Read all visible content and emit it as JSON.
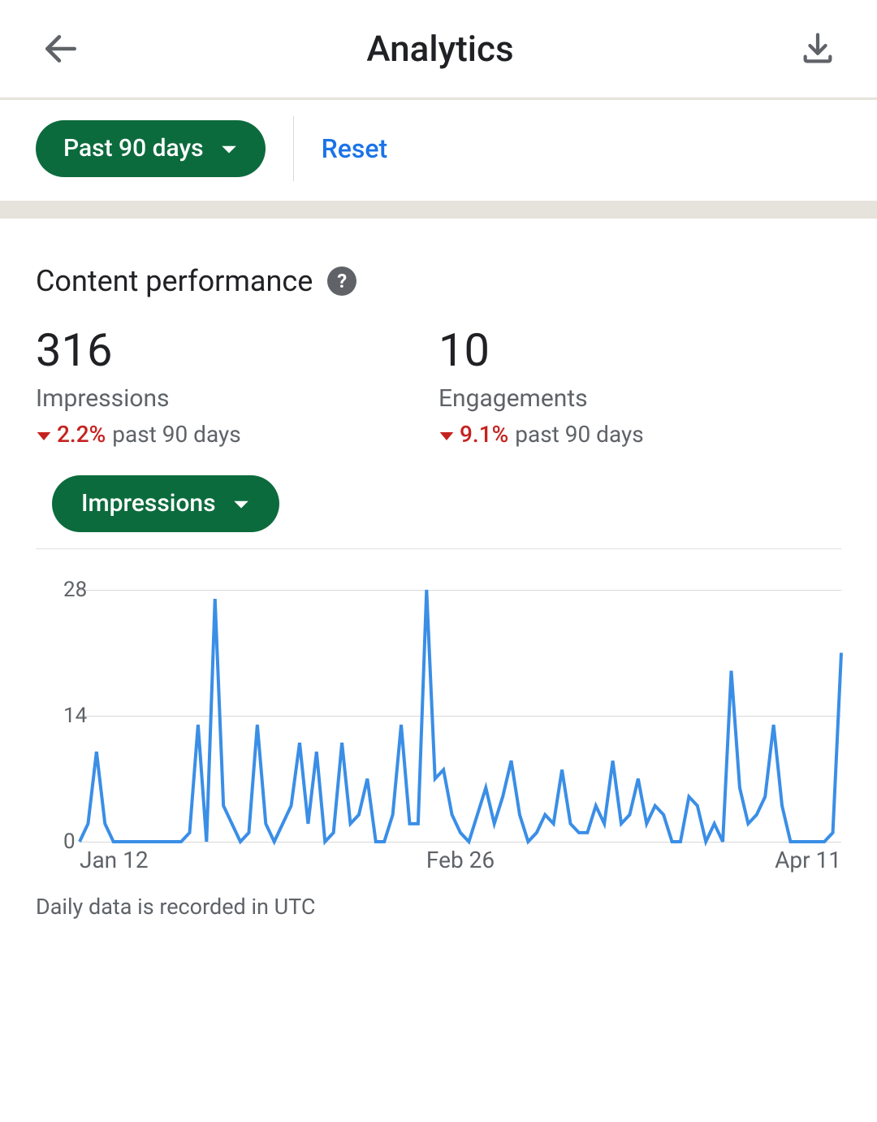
{
  "header": {
    "title": "Analytics"
  },
  "filter": {
    "range_label": "Past 90 days",
    "reset_label": "Reset"
  },
  "content": {
    "section_title": "Content performance",
    "metrics": [
      {
        "value": "316",
        "label": "Impressions",
        "delta": "2.2%",
        "direction": "down",
        "period": "past 90 days"
      },
      {
        "value": "10",
        "label": "Engagements",
        "delta": "9.1%",
        "direction": "down",
        "period": "past 90 days"
      }
    ],
    "metric_selector_label": "Impressions",
    "footnote": "Daily data is recorded in UTC"
  },
  "chart_data": {
    "type": "line",
    "title": "",
    "xlabel": "",
    "ylabel": "",
    "ylim": [
      0,
      28
    ],
    "y_ticks": [
      0,
      14,
      28
    ],
    "x_tick_labels": [
      "Jan 12",
      "Feb 26",
      "Apr 11"
    ],
    "x_tick_positions": [
      0,
      45,
      90
    ],
    "series": [
      {
        "name": "Impressions",
        "color": "#3a8ee6",
        "x": [
          0,
          1,
          2,
          3,
          4,
          5,
          6,
          7,
          8,
          9,
          10,
          11,
          12,
          13,
          14,
          15,
          16,
          17,
          18,
          19,
          20,
          21,
          22,
          23,
          24,
          25,
          26,
          27,
          28,
          29,
          30,
          31,
          32,
          33,
          34,
          35,
          36,
          37,
          38,
          39,
          40,
          41,
          42,
          43,
          44,
          45,
          46,
          47,
          48,
          49,
          50,
          51,
          52,
          53,
          54,
          55,
          56,
          57,
          58,
          59,
          60,
          61,
          62,
          63,
          64,
          65,
          66,
          67,
          68,
          69,
          70,
          71,
          72,
          73,
          74,
          75,
          76,
          77,
          78,
          79,
          80,
          81,
          82,
          83,
          84,
          85,
          86,
          87,
          88,
          89,
          90
        ],
        "y": [
          0,
          2,
          10,
          2,
          0,
          0,
          0,
          0,
          0,
          0,
          0,
          0,
          0,
          1,
          13,
          0,
          27,
          4,
          2,
          0,
          1,
          13,
          2,
          0,
          2,
          4,
          11,
          2,
          10,
          0,
          1,
          11,
          2,
          3,
          7,
          0,
          0,
          3,
          13,
          2,
          2,
          28,
          7,
          8,
          3,
          1,
          0,
          3,
          6,
          2,
          5,
          9,
          3,
          0,
          1,
          3,
          2,
          8,
          2,
          1,
          1,
          4,
          2,
          9,
          2,
          3,
          7,
          2,
          4,
          3,
          0,
          0,
          5,
          4,
          0,
          2,
          0,
          19,
          6,
          2,
          3,
          5,
          13,
          4,
          0,
          0,
          0,
          0,
          0,
          1,
          21
        ]
      }
    ]
  }
}
